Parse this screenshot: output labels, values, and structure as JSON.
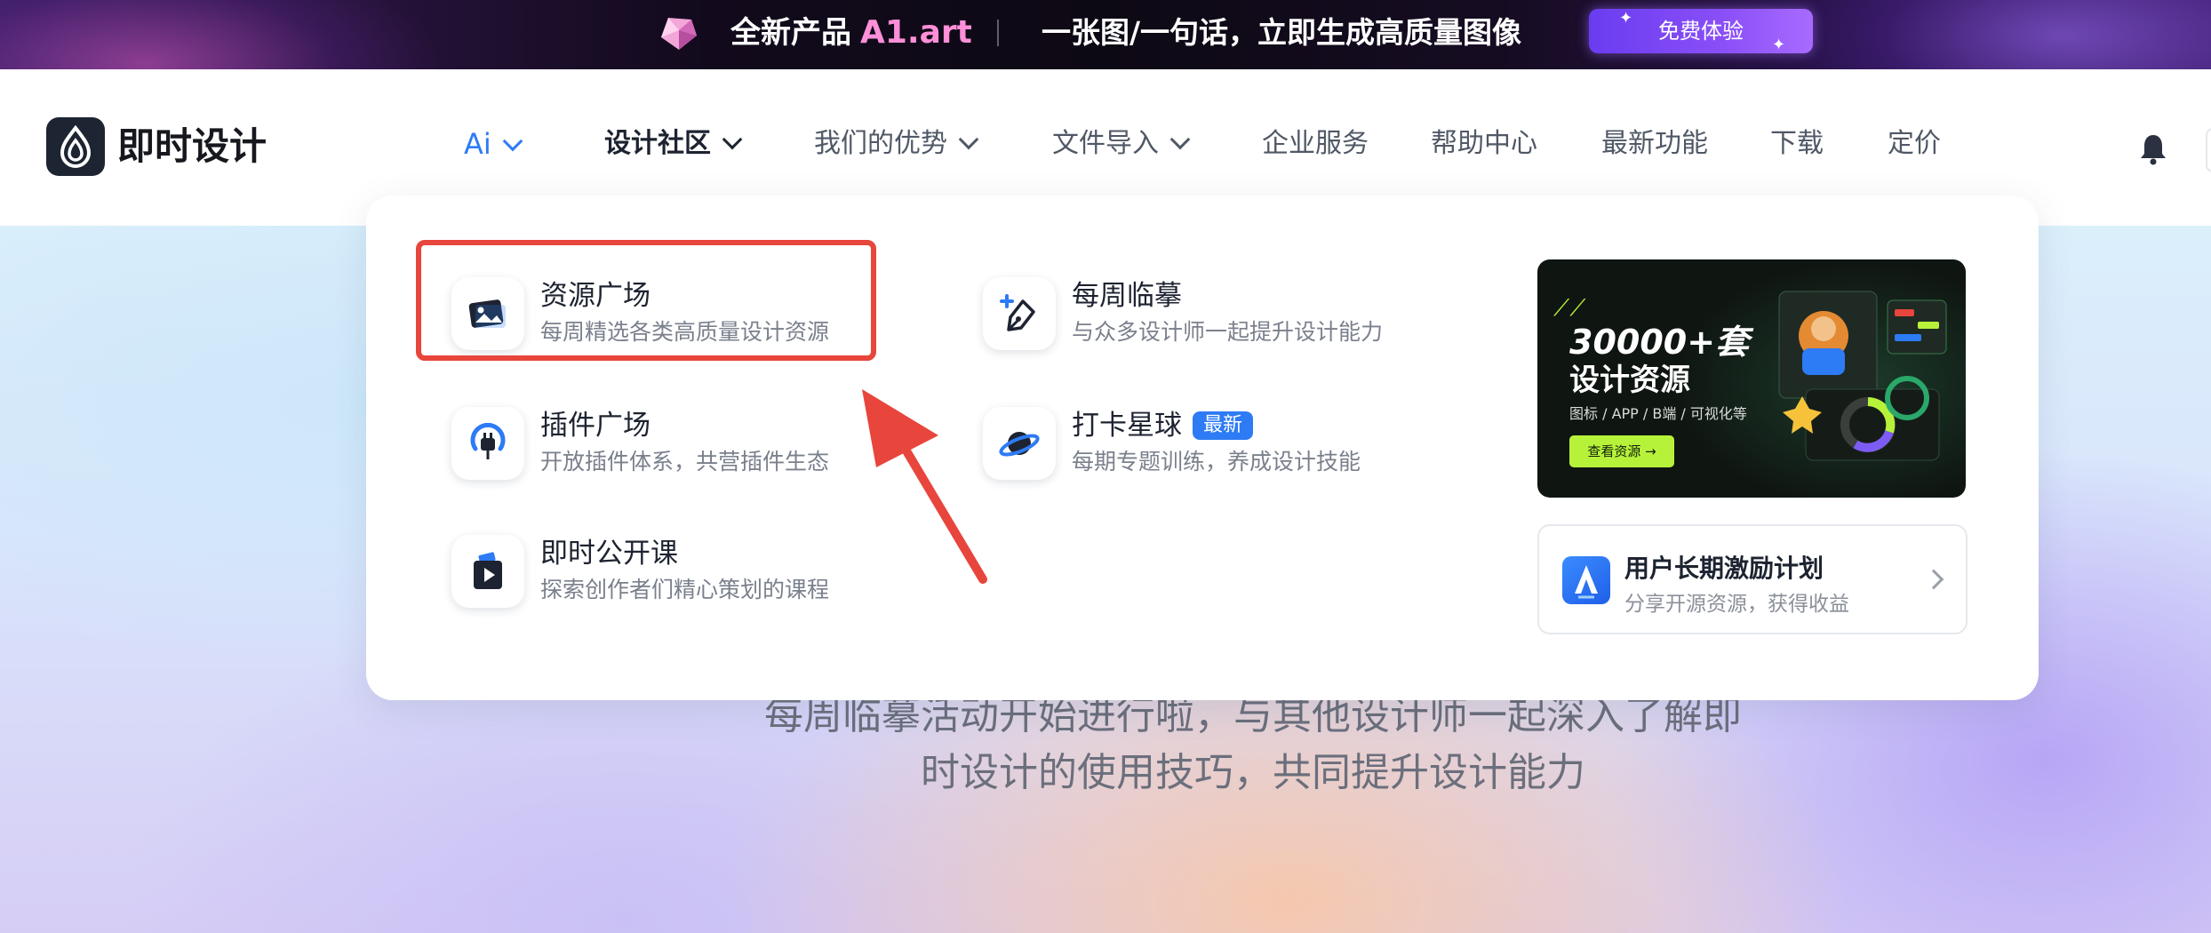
{
  "promo": {
    "title": "全新产品",
    "brand": "A1.art",
    "slogan": "一张图/一句话，立即生成高质量图像",
    "cta": "免费体验"
  },
  "header": {
    "logo_text": "即时设计",
    "nav": [
      {
        "label": "Ai",
        "dropdown": true,
        "state": "normal"
      },
      {
        "label": "设计社区",
        "dropdown": true,
        "state": "active"
      },
      {
        "label": "我们的优势",
        "dropdown": true,
        "state": "normal"
      },
      {
        "label": "文件导入",
        "dropdown": true,
        "state": "normal"
      },
      {
        "label": "企业服务",
        "dropdown": false,
        "state": "normal"
      },
      {
        "label": "帮助中心",
        "dropdown": false,
        "state": "normal"
      },
      {
        "label": "最新功能",
        "dropdown": false,
        "state": "normal"
      },
      {
        "label": "下载",
        "dropdown": false,
        "state": "normal"
      },
      {
        "label": "定价",
        "dropdown": false,
        "state": "normal"
      }
    ],
    "notification_icon": "bell-icon"
  },
  "dropdown": {
    "entries": [
      {
        "title": "资源广场",
        "desc": "每周精选各类高质量设计资源",
        "icon": "image-icon"
      },
      {
        "title": "插件广场",
        "desc": "开放插件体系，共营插件生态",
        "icon": "plug-icon"
      },
      {
        "title": "即时公开课",
        "desc": "探索创作者们精心策划的课程",
        "icon": "play-icon"
      },
      {
        "title": "每周临摹",
        "desc": "与众多设计师一起提升设计能力",
        "icon": "pen-icon"
      },
      {
        "title": "打卡星球",
        "desc": "每期专题训练，养成设计技能",
        "icon": "planet-icon",
        "badge": "最新"
      }
    ],
    "resource_card": {
      "headline": "30000+套",
      "subtitle": "设计资源",
      "tags": "图标 / APP / B端 / 可视化等",
      "button": "查看资源 →"
    },
    "incentive": {
      "title": "用户长期激励计划",
      "desc": "分享开源资源，获得收益"
    }
  },
  "hero": {
    "text_line1": "每周临摹活动开始进行啦，与其他设计师一起深入了解即",
    "text_line2": "时设计的使用技巧，共同提升设计能力"
  },
  "colors": {
    "accent": "#2d7bf5",
    "highlight": "#e8453c",
    "dark": "#1d2330"
  }
}
